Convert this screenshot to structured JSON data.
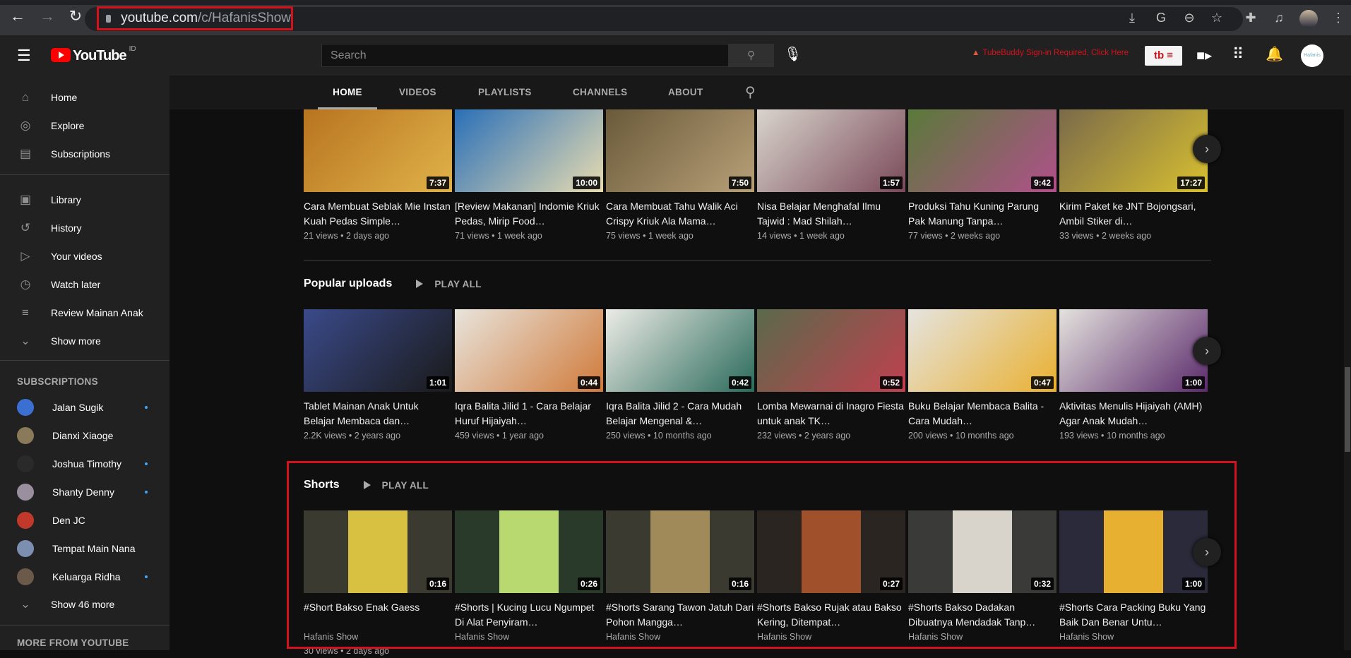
{
  "browser": {
    "url_domain": "youtube.com",
    "url_path": "/c/HafanisShow",
    "icons": [
      "back-icon",
      "forward-icon",
      "reload-icon",
      "lock-icon",
      "install-icon",
      "translate-icon",
      "zoom-out-icon",
      "star-icon",
      "extensions-icon",
      "media-icon",
      "profile-avatar",
      "menu-icon"
    ]
  },
  "header": {
    "logo_text": "YouTube",
    "country_code": "ID",
    "search_placeholder": "Search",
    "tubebuddy_notice": "TubeBuddy Sign-in Required, Click Here",
    "tubebuddy_button": "tb ≡",
    "avatar_text": "Hafanis"
  },
  "tabs": [
    {
      "label": "HOME",
      "active": true
    },
    {
      "label": "VIDEOS"
    },
    {
      "label": "PLAYLISTS"
    },
    {
      "label": "CHANNELS"
    },
    {
      "label": "ABOUT"
    }
  ],
  "sidebar": {
    "main": [
      {
        "label": "Home",
        "icon": "⌂"
      },
      {
        "label": "Explore",
        "icon": "◎"
      },
      {
        "label": "Subscriptions",
        "icon": "▤"
      }
    ],
    "library": [
      {
        "label": "Library",
        "icon": "▣"
      },
      {
        "label": "History",
        "icon": "↺"
      },
      {
        "label": "Your videos",
        "icon": "▷"
      },
      {
        "label": "Watch later",
        "icon": "◷"
      },
      {
        "label": "Review Mainan Anak",
        "icon": "≡"
      },
      {
        "label": "Show more",
        "icon": "⌄"
      }
    ],
    "subscriptions_heading": "SUBSCRIPTIONS",
    "subscriptions": [
      {
        "label": "Jalan Sugik",
        "color": "#3b6fd1",
        "dot": true
      },
      {
        "label": "Dianxi Xiaoge",
        "color": "#8a7a5a",
        "dot": false
      },
      {
        "label": "Joshua Timothy",
        "color": "#2a2a2a",
        "dot": true
      },
      {
        "label": "Shanty Denny",
        "color": "#9a8f9f",
        "dot": true
      },
      {
        "label": "Den JC",
        "color": "#c0392b",
        "dot": false
      },
      {
        "label": "Tempat Main Nana",
        "color": "#7c8fb0",
        "dot": false
      },
      {
        "label": "Keluarga Ridha",
        "color": "#6b5a4a",
        "dot": true
      }
    ],
    "show_more_subs": "Show 46 more",
    "more_heading": "MORE FROM YOUTUBE"
  },
  "rows": [
    {
      "heading": "",
      "videos": [
        {
          "title": "Cara Membuat Seblak Mie Instan Kuah Pedas Simple…",
          "meta": "21 views • 2 days ago",
          "duration": "7:37",
          "c1": "#b8741f",
          "c2": "#e0b24a"
        },
        {
          "title": "[Review Makanan] Indomie Kriuk Pedas, Mirip Food…",
          "meta": "71 views • 1 week ago",
          "duration": "10:00",
          "c1": "#2a6fb8",
          "c2": "#e8dcb0"
        },
        {
          "title": "Cara Membuat Tahu Walik Aci Crispy Kriuk Ala Mama…",
          "meta": "75 views • 1 week ago",
          "duration": "7:50",
          "c1": "#6a5a3a",
          "c2": "#b8a078"
        },
        {
          "title": "Nisa Belajar Menghafal Ilmu Tajwid : Mad Shilah…",
          "meta": "14 views • 1 week ago",
          "duration": "1:57",
          "c1": "#d8d4cc",
          "c2": "#7a4a5a"
        },
        {
          "title": "Produksi Tahu Kuning Parung Pak Manung Tanpa…",
          "meta": "77 views • 2 weeks ago",
          "duration": "9:42",
          "c1": "#5a7a3a",
          "c2": "#b0508a"
        },
        {
          "title": "Kirim Paket ke JNT Bojongsari, Ambil Stiker di…",
          "meta": "33 views • 2 weeks ago",
          "duration": "17:27",
          "c1": "#7a6a4a",
          "c2": "#d8c030"
        }
      ]
    },
    {
      "heading": "Popular uploads",
      "play_all": "PLAY ALL",
      "videos": [
        {
          "title": "Tablet Mainan Anak Untuk Belajar Membaca dan…",
          "meta": "2.2K views • 2 years ago",
          "duration": "1:01",
          "c1": "#3a4a8a",
          "c2": "#1a1a1a"
        },
        {
          "title": "Iqra Balita Jilid 1 - Cara Belajar Huruf Hijaiyah…",
          "meta": "459 views • 1 year ago",
          "duration": "0:44",
          "c1": "#e8e4dc",
          "c2": "#d07a3a"
        },
        {
          "title": "Iqra Balita Jilid 2 - Cara Mudah Belajar Mengenal &…",
          "meta": "250 views • 10 months ago",
          "duration": "0:42",
          "c1": "#ecebe6",
          "c2": "#2a6a5a"
        },
        {
          "title": "Lomba Mewarnai di Inagro Fiesta untuk anak TK…",
          "meta": "232 views • 2 years ago",
          "duration": "0:52",
          "c1": "#5a6a4a",
          "c2": "#c04050"
        },
        {
          "title": "Buku Belajar Membaca Balita - Cara Mudah…",
          "meta": "200 views • 10 months ago",
          "duration": "0:47",
          "c1": "#e6e4e0",
          "c2": "#e8b030"
        },
        {
          "title": "Aktivitas Menulis Hijaiyah (AMH) Agar Anak Mudah…",
          "meta": "193 views • 10 months ago",
          "duration": "1:00",
          "c1": "#e4e2de",
          "c2": "#5a2a6a"
        }
      ]
    },
    {
      "heading": "Shorts",
      "play_all": "PLAY ALL",
      "videos": [
        {
          "title": "#Short Bakso Enak Gaess",
          "channel": "Hafanis Show",
          "meta": "30 views • 2 days ago",
          "duration": "0:16",
          "c1": "#3a3a30",
          "c2": "#d8c040"
        },
        {
          "title": "#Shorts | Kucing Lucu Ngumpet Di Alat Penyiram…",
          "channel": "Hafanis Show",
          "duration": "0:26",
          "c1": "#2a3a2a",
          "c2": "#b8d870"
        },
        {
          "title": "#Shorts Sarang Tawon Jatuh Dari Pohon Mangga…",
          "channel": "Hafanis Show",
          "duration": "0:16",
          "c1": "#3a3a30",
          "c2": "#a08a5a"
        },
        {
          "title": "#Shorts Bakso Rujak atau Bakso Kering, Ditempat…",
          "channel": "Hafanis Show",
          "duration": "0:27",
          "c1": "#2a2520",
          "c2": "#a0502a"
        },
        {
          "title": "#Shorts Bakso Dadakan Dibuatnya Mendadak Tanp…",
          "channel": "Hafanis Show",
          "duration": "0:32",
          "c1": "#3a3a38",
          "c2": "#d8d4cc"
        },
        {
          "title": "#Shorts Cara Packing Buku Yang Baik Dan Benar Untu…",
          "channel": "Hafanis Show",
          "duration": "1:00",
          "c1": "#2a2a3a",
          "c2": "#e8b030"
        }
      ]
    }
  ],
  "colors": {
    "highlight_box": "#d3121b",
    "youtube_red": "#ff0000",
    "subscription_dot": "#3ea6ff"
  }
}
